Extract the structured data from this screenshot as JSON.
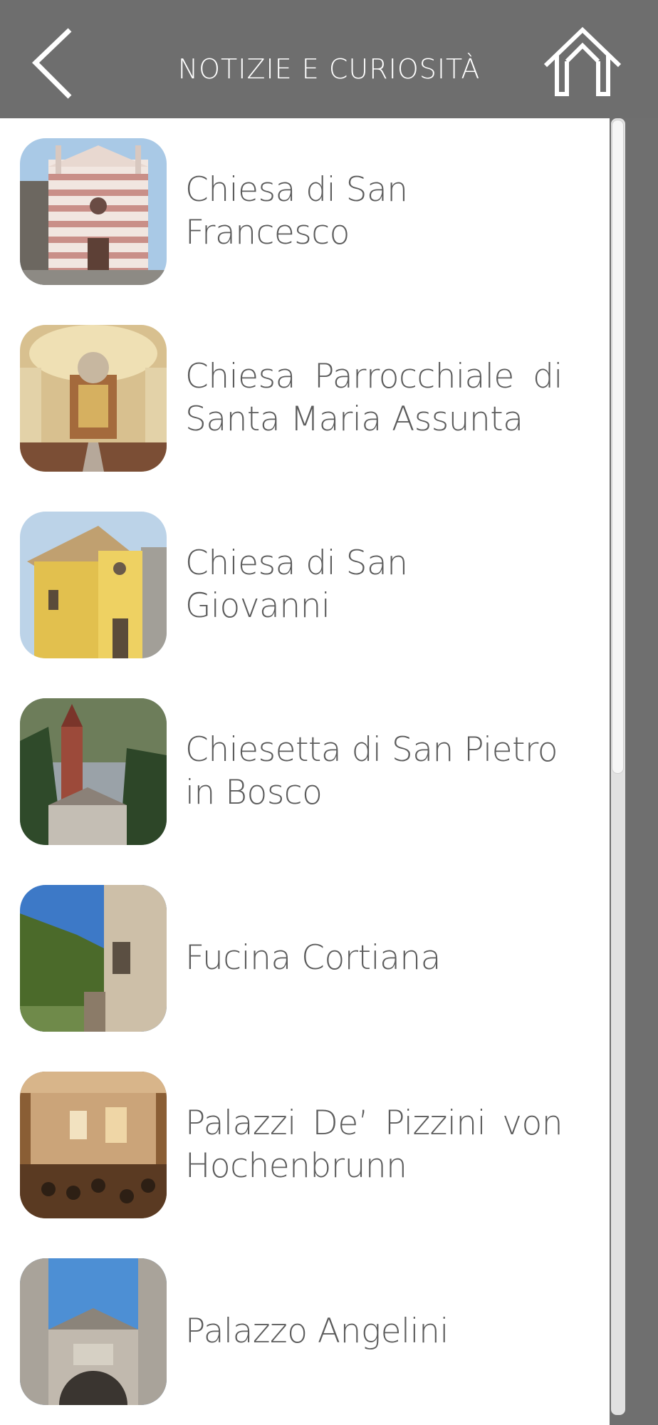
{
  "header": {
    "title": "NOTIZIE E CURIOSITÀ",
    "back_icon": "chevron-left-icon",
    "home_icon": "home-icon",
    "background": "#6e6e6e"
  },
  "list": {
    "items": [
      {
        "label": "Chiesa di San Francesco",
        "thumbnail": "church-striped-facade"
      },
      {
        "label": "Chiesa Parrocchiale di Santa Maria Assunta",
        "thumbnail": "church-interior-altar"
      },
      {
        "label": "Chiesa di San Giovanni",
        "thumbnail": "yellow-church-facade"
      },
      {
        "label": "Chiesetta di San Pietro in Bosco",
        "thumbnail": "bell-tower-trees"
      },
      {
        "label": "Fucina Cortiana",
        "thumbnail": "stone-forge-valley"
      },
      {
        "label": "Palazzi De’ Pizzini von Hochenbrunn",
        "thumbnail": "palace-hall-concert"
      },
      {
        "label": "Palazzo Angelini",
        "thumbnail": "palace-portal-sky"
      }
    ]
  },
  "colors": {
    "text": "#5c5c5c",
    "list_background": "#ffffff",
    "scrollbar_track": "#e1e1e1"
  }
}
